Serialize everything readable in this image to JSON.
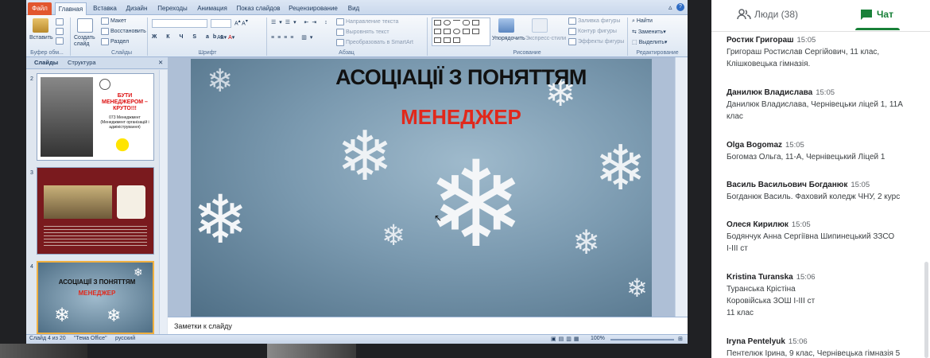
{
  "ribbon_tabs": [
    "Файл",
    "Главная",
    "Вставка",
    "Дизайн",
    "Переходы",
    "Анимация",
    "Показ слайдов",
    "Рецензирование",
    "Вид"
  ],
  "ribbon": {
    "paste": "Вставить",
    "clipboard_group": "Буфер обм...",
    "create_slide": "Создать слайд",
    "layout": "Макет",
    "reset": "Восстановить",
    "section": "Раздел",
    "slides_group": "Слайды",
    "font_group": "Шрифт",
    "paragraph_group": "Абзац",
    "text_direction": "Направление текста",
    "align_text": "Выровнять текст",
    "smartart": "Преобразовать в SmartArt",
    "arrange": "Упорядочить",
    "quick_styles": "Экспресс-стили",
    "shape_fill": "Заливка фигуры",
    "shape_outline": "Контур фигуры",
    "shape_effects": "Эффекты фигуры",
    "drawing_group": "Рисование",
    "find": "Найти",
    "replace": "Заменить",
    "select": "Выделить",
    "editing_group": "Редактирование"
  },
  "pane": {
    "tab_slides": "Слайды",
    "tab_outline": "Структура",
    "slides": [
      {
        "num": "2",
        "headline": "БУТИ МЕНЕДЖЕРОМ – КРУТО!!!",
        "body": "073 Менеджмент (Менеджмент організацій і адміністрування)"
      },
      {
        "num": "3"
      },
      {
        "num": "4",
        "headline": "АСОЦІАЦІЇ З ПОНЯТТЯМ",
        "sub": "МЕНЕДЖЕР"
      }
    ]
  },
  "slide": {
    "title": "АСОЦІАЦІЇ З ПОНЯТТЯМ",
    "subtitle": "МЕНЕДЖЕР"
  },
  "notes_placeholder": "Заметки к слайду",
  "status": {
    "slide_of": "Слайд 4 из 20",
    "theme": "\"Тема Office\"",
    "language": "русский",
    "zoom": "100%"
  },
  "chat": {
    "people_label": "Люди (38)",
    "chat_label": "Чат",
    "messages": [
      {
        "name": "Ростик Григораш",
        "time": "15:05",
        "text": [
          "Григораш Ростислав Сергійович, 11 клас,",
          "Клішковецька гімназія."
        ]
      },
      {
        "name": "Данилюк Владислава",
        "time": "15:05",
        "text": [
          "Данилюк Владислава, Чернівецьки ліцей 1, 11А",
          "клас"
        ]
      },
      {
        "name": "Olga Bogomaz",
        "time": "15:05",
        "text": [
          "Богомаз Ольга, 11-А, Чернівецький Ліцей 1"
        ]
      },
      {
        "name": "Василь Васильович Богданюк",
        "time": "15:05",
        "text": [
          "Богданюк Василь. Фаховий коледж ЧНУ, 2 курс"
        ]
      },
      {
        "name": "Олеся Кирилюк",
        "time": "15:05",
        "text": [
          "Бодянчук   Анна Сергіївна  Шипинецький ЗЗСО",
          "І-ІІІ ст"
        ]
      },
      {
        "name": "Kristina Turanska",
        "time": "15:06",
        "text": [
          "Туранська Крістіна",
          "Коровійська ЗОШ І-ІІІ ст",
          "11 клас"
        ]
      },
      {
        "name": "Iryna Pentelyuk",
        "time": "15:06",
        "text": [
          "Пентелюк Ірина, 9 клас, Чернівецька гімназія 5"
        ]
      }
    ]
  },
  "colors": {
    "accent": "#188038",
    "file_tab": "#e2562e",
    "slide_subtitle": "#e1281b"
  }
}
